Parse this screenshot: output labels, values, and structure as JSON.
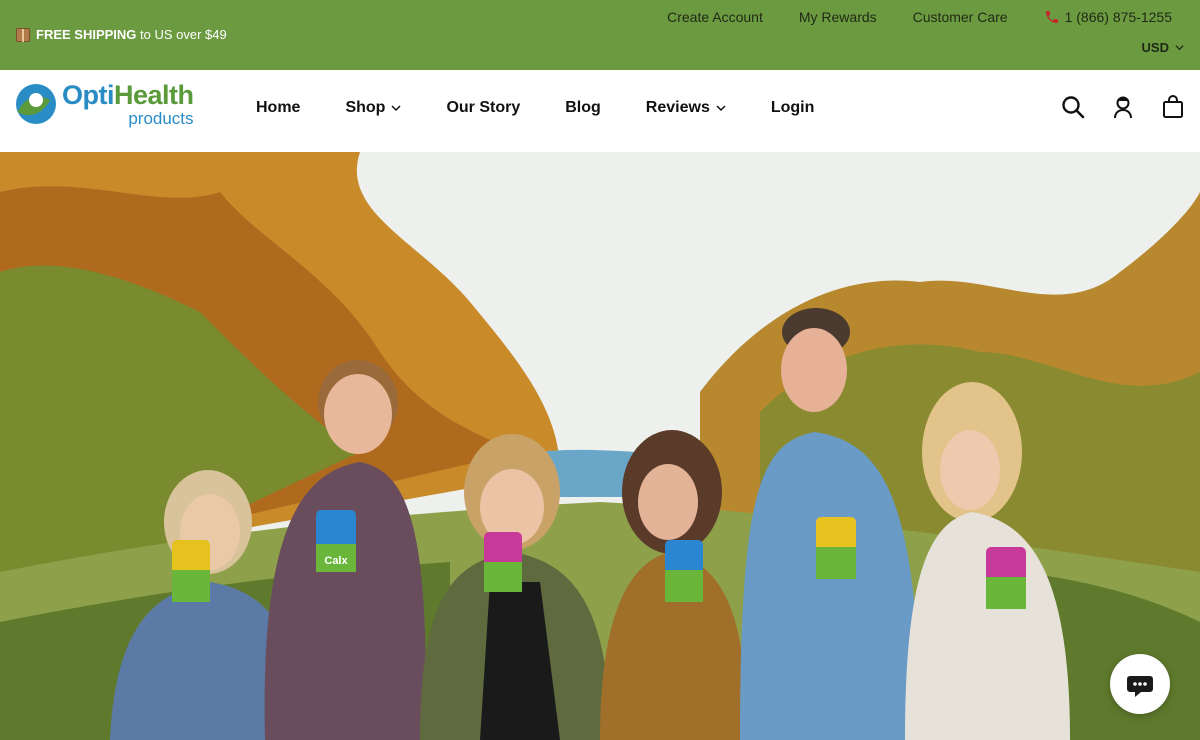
{
  "announcement": {
    "shipping_bold": "FREE SHIPPING",
    "shipping_rest": " to US over $49",
    "links": [
      "Create Account",
      "My Rewards",
      "Customer Care"
    ],
    "phone": "1 (866) 875-1255",
    "currency": "USD"
  },
  "brand": {
    "name_part1": "Opti",
    "name_part2": "Health",
    "name_sub": "products"
  },
  "nav": {
    "items": [
      {
        "label": "Home",
        "dropdown": false
      },
      {
        "label": "Shop",
        "dropdown": true
      },
      {
        "label": "Our Story",
        "dropdown": false
      },
      {
        "label": "Blog",
        "dropdown": false
      },
      {
        "label": "Reviews",
        "dropdown": true
      },
      {
        "label": "Login",
        "dropdown": false
      }
    ]
  },
  "header_icons": [
    "search-icon",
    "account-icon",
    "cart-icon"
  ],
  "hero": {
    "image_alt": "Group of six people in a vineyard holding OptiHealth supplement bottles",
    "bottle_labels": [
      "Calx"
    ]
  },
  "chat": {
    "icon": "chat-icon"
  },
  "colors": {
    "topbar": "#6c9a40",
    "brand_blue": "#2a8cc4",
    "brand_green": "#5a9a3a"
  }
}
